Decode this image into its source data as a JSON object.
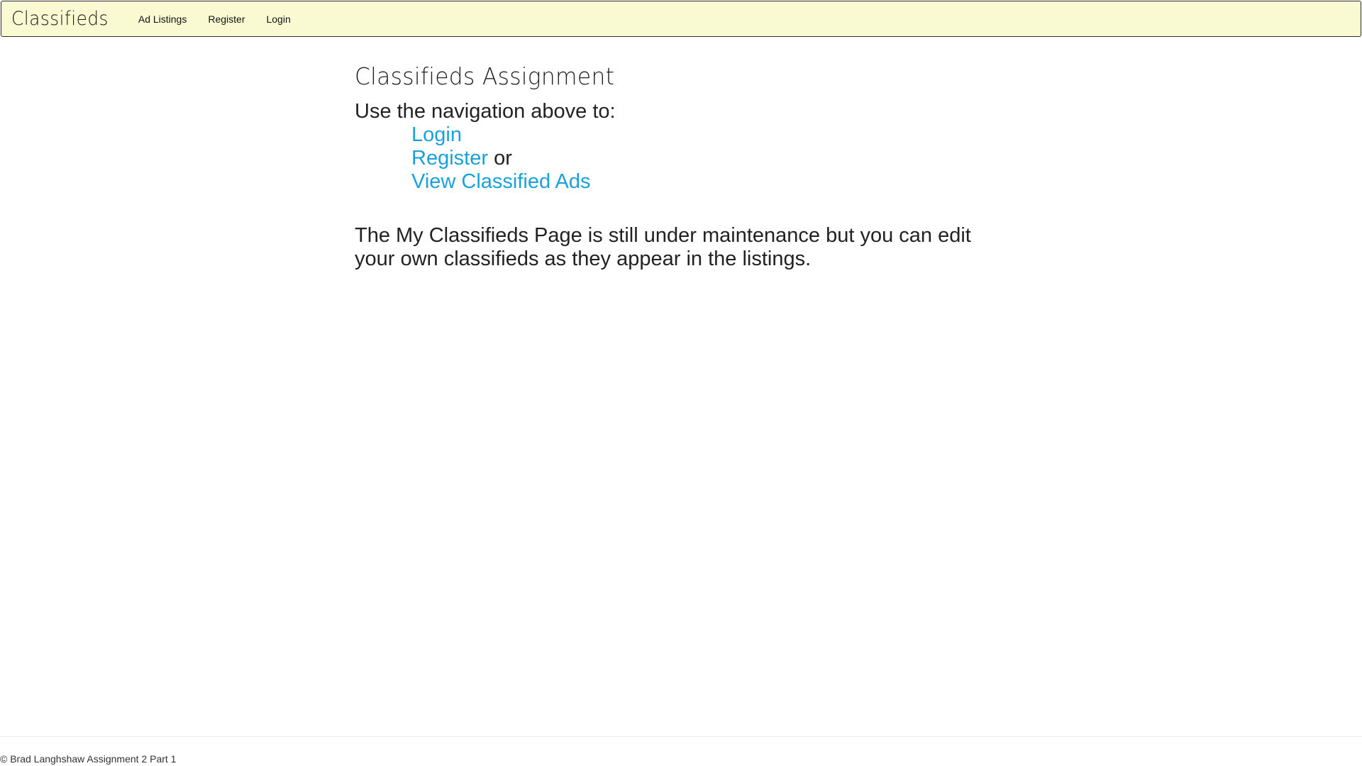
{
  "navbar": {
    "brand": "Classifieds",
    "links": [
      {
        "label": "Ad Listings"
      },
      {
        "label": "Register"
      },
      {
        "label": "Login"
      }
    ],
    "background": "#fafad2"
  },
  "main": {
    "title": "Classifieds Assignment",
    "intro": "Use the navigation above to:",
    "options": {
      "login": "Login",
      "register": "Register",
      "or": "or",
      "view_ads": "View Classified Ads"
    },
    "notice": "The My Classifieds Page is still under maintenance but you can edit your own classifieds as they appear in the listings."
  },
  "footer": {
    "text": "© Brad Langhshaw Assignment 2 Part 1"
  },
  "colors": {
    "link": "#1aa1dc",
    "text": "#222222"
  }
}
